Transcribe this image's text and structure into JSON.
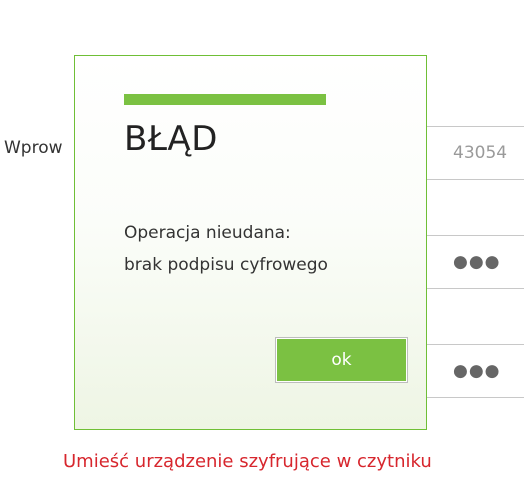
{
  "background_form": {
    "field_label": "Wprow",
    "field1_value": "43054",
    "field2_mask": "●●●",
    "field3_mask": "●●●",
    "error_message": "Umieść urządzenie szyfrujące w czytniku"
  },
  "dialog": {
    "title": "BŁĄD",
    "message_line1": "Operacja nieudana:",
    "message_line2": "brak podpisu cyfrowego",
    "ok_label": "ok"
  },
  "colors": {
    "accent": "#7bc142",
    "error": "#d7262d",
    "dialog_border": "#6fbf36"
  }
}
